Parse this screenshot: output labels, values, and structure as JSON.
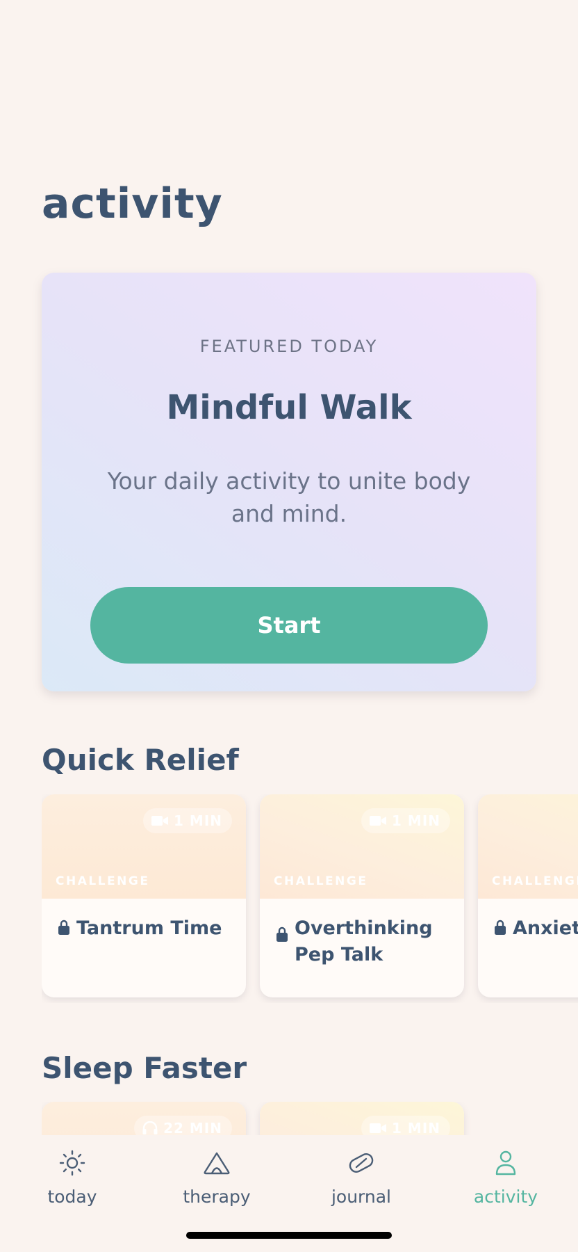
{
  "header": {
    "title": "activity"
  },
  "featured": {
    "kicker": "FEATURED TODAY",
    "title": "Mindful Walk",
    "description": "Your daily activity to unite body and mind.",
    "button_label": "Start"
  },
  "quick_relief": {
    "title": "Quick Relief",
    "cards": [
      {
        "tag": "CHALLENGE",
        "duration": "1 MIN",
        "media_icon": "video-icon",
        "name": "Tantrum Time",
        "locked": true
      },
      {
        "tag": "CHALLENGE",
        "duration": "1 MIN",
        "media_icon": "video-icon",
        "name": "Overthinking Pep Talk",
        "locked": true
      },
      {
        "tag": "CHALLENGE",
        "duration": "",
        "media_icon": "",
        "name": "Anxiety",
        "locked": true
      }
    ]
  },
  "sleep_faster": {
    "title": "Sleep Faster",
    "cards": [
      {
        "duration": "22 MIN",
        "media_icon": "headphones-icon"
      },
      {
        "duration": "1 MIN",
        "media_icon": "video-icon"
      }
    ]
  },
  "nav": {
    "items": [
      {
        "label": "today",
        "icon": "sun-icon",
        "active": false
      },
      {
        "label": "therapy",
        "icon": "therapy-icon",
        "active": false
      },
      {
        "label": "journal",
        "icon": "journal-icon",
        "active": false
      },
      {
        "label": "activity",
        "icon": "person-icon",
        "active": true
      }
    ]
  },
  "colors": {
    "background": "#faf3ef",
    "accent": "#54b5a0",
    "text": "#3d5470"
  }
}
